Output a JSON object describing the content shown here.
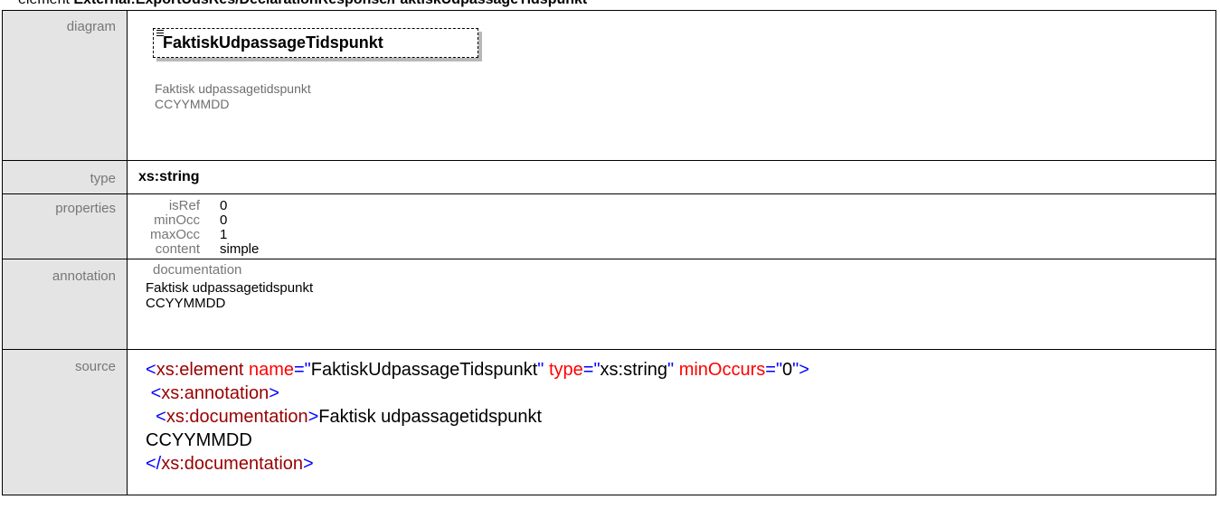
{
  "heading": {
    "kind": "element",
    "path": "External:ExportUdsRes/DeclarationResponse/FaktiskUdpassageTidspunkt"
  },
  "rows": {
    "diagram_label": "diagram",
    "type_label": "type",
    "properties_label": "properties",
    "annotation_label": "annotation",
    "source_label": "source"
  },
  "diagram": {
    "node_name": "FaktiskUdpassageTidspunkt",
    "doc_text": "Faktisk udpassagetidspunkt\nCCYYMMDD"
  },
  "type_value": "xs:string",
  "properties": [
    {
      "key": "isRef",
      "value": "0"
    },
    {
      "key": "minOcc",
      "value": "0"
    },
    {
      "key": "maxOcc",
      "value": "1"
    },
    {
      "key": "content",
      "value": "simple"
    }
  ],
  "annotation": {
    "key": "documentation",
    "text": "Faktisk udpassagetidspunkt\nCCYYMMDD"
  },
  "source": {
    "line1": {
      "open": "<",
      "tag": "xs:element",
      "attr1": "name",
      "val1": "FaktiskUdpassageTidspunkt",
      "attr2": "type",
      "val2": "xs:string",
      "attr3": "minOccurs",
      "val3": "0",
      "close": ">"
    },
    "line2_tag": "xs:annotation",
    "line3_tag": "xs:documentation",
    "line3_text": "Faktisk udpassagetidspunkt",
    "line4_text": "CCYYMMDD",
    "line5_tag": "xs:documentation"
  }
}
